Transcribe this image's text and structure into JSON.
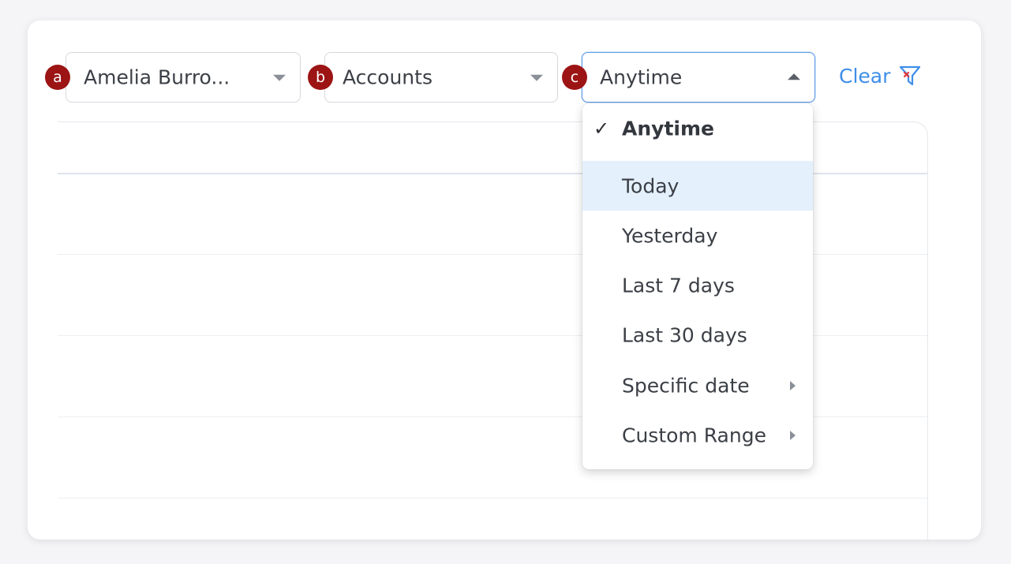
{
  "filters": {
    "owner": {
      "badge": "a",
      "value": "Amelia Burro..."
    },
    "module": {
      "badge": "b",
      "value": "Accounts"
    },
    "time": {
      "badge": "c",
      "value": "Anytime"
    }
  },
  "clear_label": "Clear",
  "time_menu": {
    "items": [
      {
        "label": "Anytime",
        "selected": true
      },
      {
        "label": "Today",
        "hovered": true
      },
      {
        "label": "Yesterday"
      },
      {
        "label": "Last 7 days"
      },
      {
        "label": "Last 30 days"
      },
      {
        "label": "Specific date",
        "has_submenu": true
      },
      {
        "label": "Custom Range",
        "has_submenu": true
      }
    ],
    "check_glyph": "✓"
  },
  "colors": {
    "badge": "#9c1414",
    "accent": "#3f8ee8",
    "hover_bg": "#e4f0fc",
    "focus_border": "#5b9be6"
  },
  "icons": {
    "clear": "filter-clear-icon"
  }
}
